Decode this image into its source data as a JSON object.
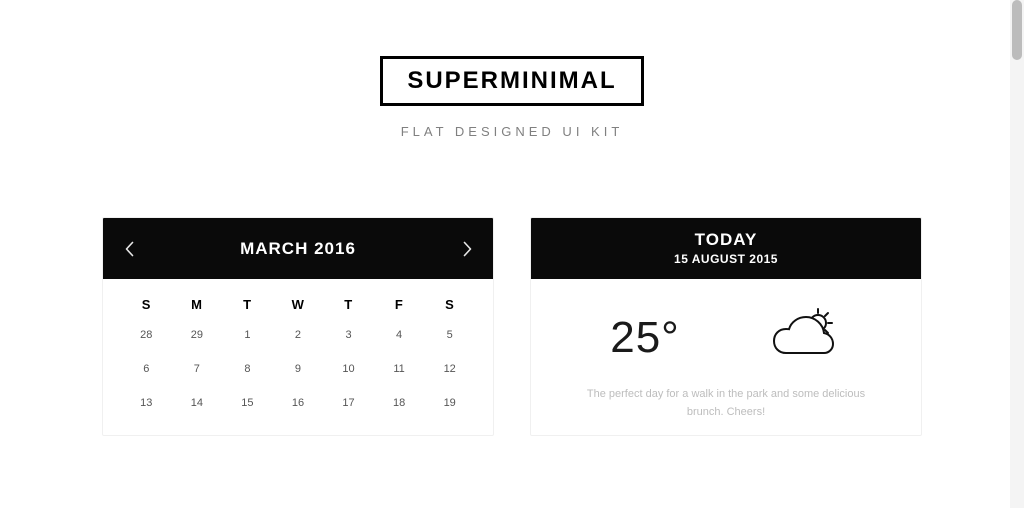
{
  "header": {
    "logo": "SUPERMINIMAL",
    "subtitle": "FLAT DESIGNED UI KIT"
  },
  "calendar": {
    "title": "MARCH 2016",
    "days": [
      "S",
      "M",
      "T",
      "W",
      "T",
      "F",
      "S"
    ],
    "rows": [
      [
        "28",
        "29",
        "1",
        "2",
        "3",
        "4",
        "5"
      ],
      [
        "6",
        "7",
        "8",
        "9",
        "10",
        "11",
        "12"
      ],
      [
        "13",
        "14",
        "15",
        "16",
        "17",
        "18",
        "19"
      ]
    ]
  },
  "weather": {
    "title": "TODAY",
    "date": "15 AUGUST 2015",
    "temp": "25°",
    "description": "The perfect day for a walk in the park and some delicious brunch. Cheers!"
  }
}
